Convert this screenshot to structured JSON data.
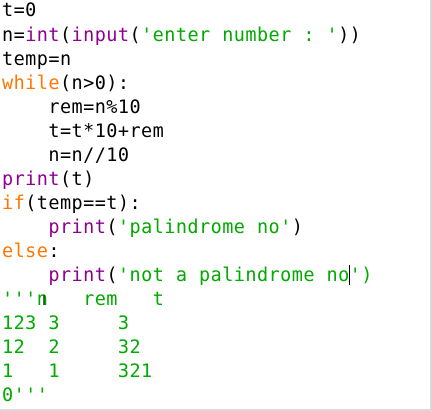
{
  "editor": {
    "lines": {
      "l1": {
        "a": "t=0"
      },
      "l2": {
        "a": "n=",
        "b": "int",
        "c": "(",
        "d": "input",
        "e": "(",
        "f": "'enter number : '",
        "g": "))"
      },
      "l3": {
        "a": "temp=n"
      },
      "l4": {
        "a": "while",
        "b": "(n>0):"
      },
      "l5": {
        "a": "    rem=n%10"
      },
      "l6": {
        "a": "    t=t*10+rem"
      },
      "l7": {
        "a": "    n=n//10"
      },
      "l8": {
        "a": "print",
        "b": "(t)"
      },
      "l9": {
        "a": "if",
        "b": "(temp==t):"
      },
      "l10": {
        "a": "    ",
        "b": "print",
        "c": "(",
        "d": "'palindrome no'",
        "e": ")"
      },
      "l11": {
        "a": "else",
        "b": ":"
      },
      "l12": {
        "a": "    ",
        "b": "print",
        "c": "(",
        "d": "'not a palindrome no",
        "e": "')"
      },
      "l13": "'''n   rem   t",
      "l14": "123 3     3",
      "l15": "12  2     32",
      "l16": "1   1     321",
      "l17": "0'''"
    },
    "mouse_cursor": "I"
  },
  "colors": {
    "keyword": "#ff7700",
    "builtin": "#900090",
    "string": "#00aa00",
    "default": "#000000"
  }
}
